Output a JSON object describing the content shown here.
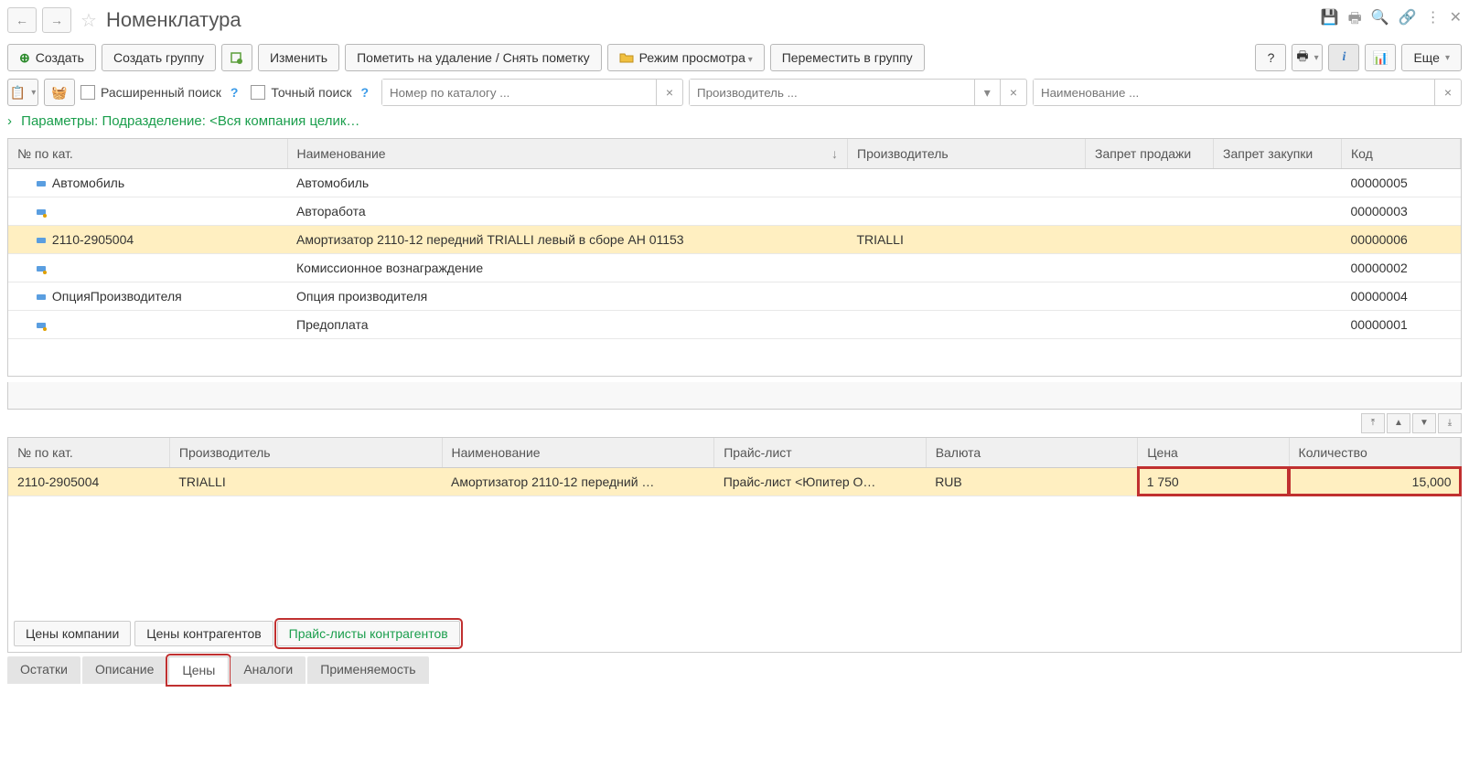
{
  "header": {
    "title": "Номенклатура"
  },
  "toolbar": {
    "create": "Создать",
    "create_group": "Создать группу",
    "edit": "Изменить",
    "mark_delete": "Пометить на удаление / Снять пометку",
    "view_mode": "Режим просмотра",
    "move_to_group": "Переместить в группу",
    "help": "?",
    "more": "Еще"
  },
  "search": {
    "extended": "Расширенный поиск",
    "exact": "Точный поиск",
    "catalog_placeholder": "Номер по каталогу ...",
    "manufacturer_placeholder": "Производитель ...",
    "name_placeholder": "Наименование ..."
  },
  "params_line": "Параметры: Подразделение: <Вся компания целик…",
  "main_table": {
    "cols": {
      "cat": "№ по кат.",
      "name": "Наименование",
      "manufacturer": "Производитель",
      "no_sale": "Запрет продажи",
      "no_purchase": "Запрет закупки",
      "code": "Код"
    },
    "rows": [
      {
        "cat": "Автомобиль",
        "name": "Автомобиль",
        "manufacturer": "",
        "code": "00000005",
        "icon": "blue"
      },
      {
        "cat": "",
        "name": "Авторабота",
        "manufacturer": "",
        "code": "00000003",
        "icon": "blue-dot"
      },
      {
        "cat": "2110-2905004",
        "name": "Амортизатор 2110-12 передний TRIALLI левый в сборе AH 01153",
        "manufacturer": "TRIALLI",
        "code": "00000006",
        "icon": "blue",
        "selected": true
      },
      {
        "cat": "",
        "name": "Комиссионное вознаграждение",
        "manufacturer": "",
        "code": "00000002",
        "icon": "blue-dot"
      },
      {
        "cat": "ОпцияПроизводителя",
        "name": "Опция производителя",
        "manufacturer": "",
        "code": "00000004",
        "icon": "blue"
      },
      {
        "cat": "",
        "name": "Предоплата",
        "manufacturer": "",
        "code": "00000001",
        "icon": "blue-dot"
      }
    ]
  },
  "detail_table": {
    "cols": {
      "cat": "№ по кат.",
      "manufacturer": "Производитель",
      "name": "Наименование",
      "pricelist": "Прайс-лист",
      "currency": "Валюта",
      "price": "Цена",
      "qty": "Количество"
    },
    "rows": [
      {
        "cat": "2110-2905004",
        "manufacturer": "TRIALLI",
        "name": "Амортизатор 2110-12 передний …",
        "pricelist": "Прайс-лист <Юпитер О…",
        "currency": "RUB",
        "price": "1 750",
        "qty": "15,000",
        "selected": true
      }
    ]
  },
  "subtabs": {
    "company_prices": "Цены компании",
    "counterparty_prices": "Цены контрагентов",
    "counterparty_pricelists": "Прайс-листы контрагентов"
  },
  "bottom_tabs": {
    "remains": "Остатки",
    "description": "Описание",
    "prices": "Цены",
    "analogs": "Аналоги",
    "applicability": "Применяемость"
  }
}
